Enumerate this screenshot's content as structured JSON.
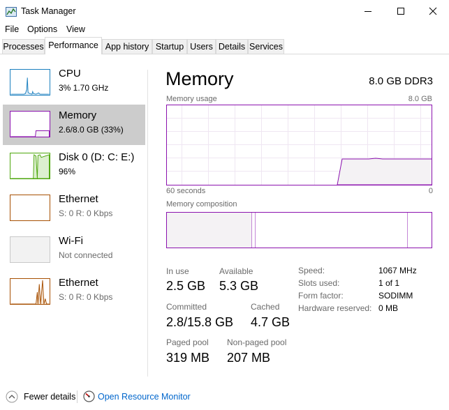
{
  "window": {
    "title": "Task Manager"
  },
  "menu": [
    "File",
    "Options",
    "View"
  ],
  "tabs": [
    "Processes",
    "Performance",
    "App history",
    "Startup",
    "Users",
    "Details",
    "Services"
  ],
  "active_tab": "Performance",
  "sidebar": [
    {
      "name": "CPU",
      "sub": "3% 1.70 GHz",
      "color": "#1a7fbf"
    },
    {
      "name": "Memory",
      "sub": "2.6/8.0 GB (33%)",
      "color": "#8b12ae"
    },
    {
      "name": "Disk 0 (D: C: E:)",
      "sub": "96%",
      "color": "#4da60c"
    },
    {
      "name": "Ethernet",
      "sub": "S: 0 R: 0 Kbps",
      "color": "#a74f01"
    },
    {
      "name": "Wi-Fi",
      "sub": "Not connected",
      "color": "#a7a7a7"
    },
    {
      "name": "Ethernet",
      "sub": "S: 0 R: 0 Kbps",
      "color": "#a74f01"
    }
  ],
  "main": {
    "title": "Memory",
    "spec": "8.0 GB DDR3",
    "usage_label": "Memory usage",
    "usage_max": "8.0 GB",
    "time_left": "60 seconds",
    "time_right": "0",
    "composition_label": "Memory composition",
    "in_use_label": "In use",
    "in_use_value": "2.5 GB",
    "available_label": "Available",
    "available_value": "5.3 GB",
    "committed_label": "Committed",
    "committed_value": "2.8/15.8 GB",
    "cached_label": "Cached",
    "cached_value": "4.7 GB",
    "paged_label": "Paged pool",
    "paged_value": "319 MB",
    "nonpaged_label": "Non-paged pool",
    "nonpaged_value": "207 MB",
    "props": [
      {
        "label": "Speed:",
        "value": "1067 MHz"
      },
      {
        "label": "Slots used:",
        "value": "1 of 1"
      },
      {
        "label": "Form factor:",
        "value": "SODIMM"
      },
      {
        "label": "Hardware reserved:",
        "value": "0 MB"
      }
    ]
  },
  "footer": {
    "fewer": "Fewer details",
    "monitor": "Open Resource Monitor"
  },
  "colors": {
    "memory": "#8b12ae",
    "memory_fill": "#f4f2f4",
    "grid": "#efe6f2"
  }
}
